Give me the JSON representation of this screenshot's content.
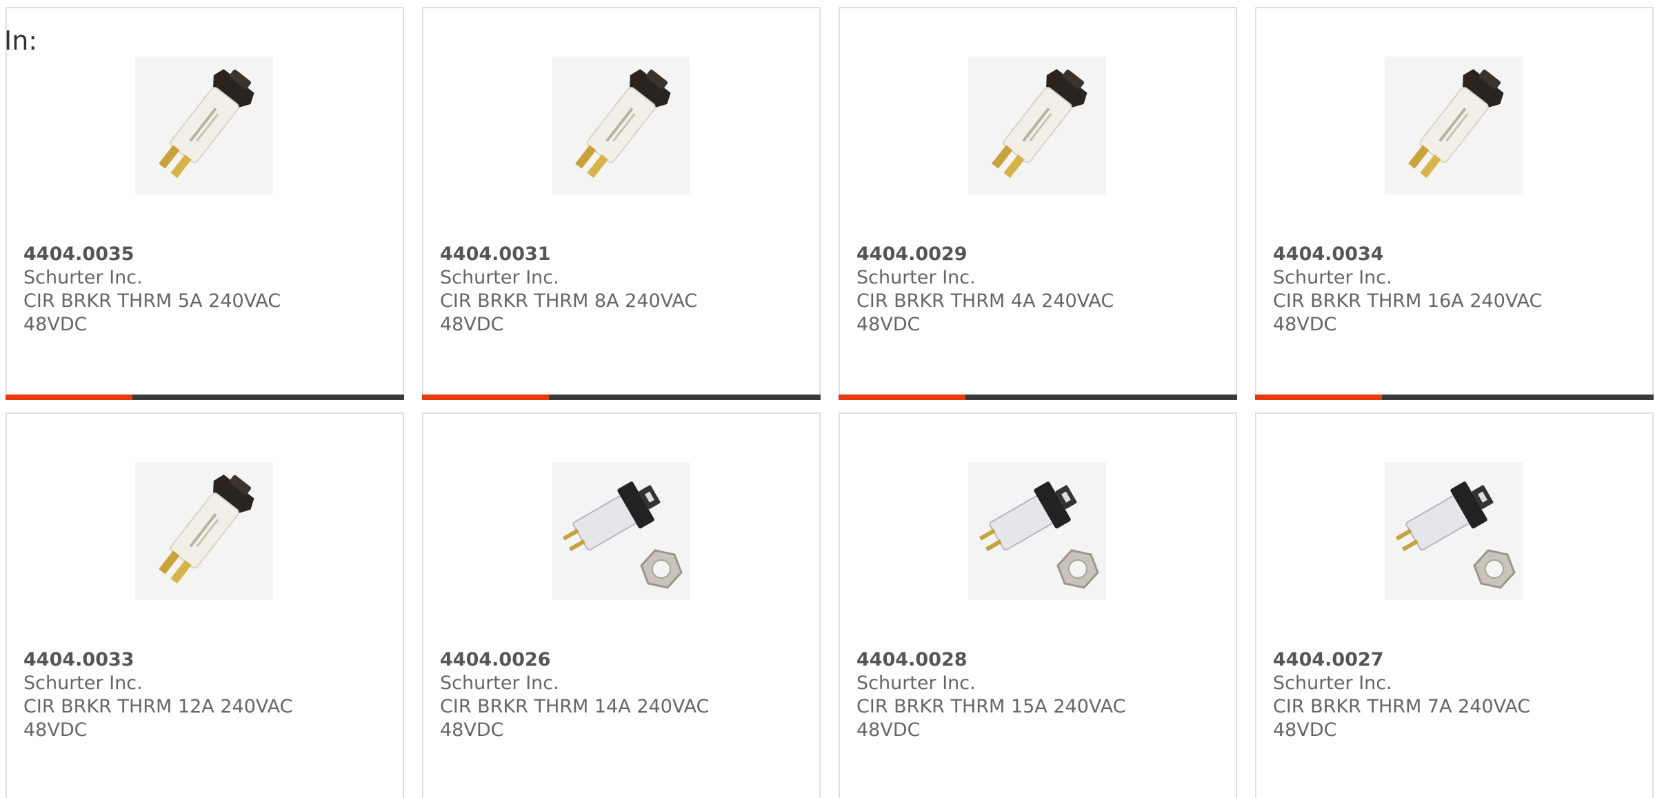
{
  "header": {
    "in_label": "In:"
  },
  "colors": {
    "accent": "#e8380d",
    "bar_dark": "#3a3a3a",
    "border": "#e0e0e0",
    "text": "#666666"
  },
  "products": [
    {
      "part_number": "4404.0035",
      "manufacturer": "Schurter Inc.",
      "desc_line1": "CIR BRKR THRM 5A 240VAC",
      "desc_line2": "48VDC",
      "image_icon": "inline-breaker-icon"
    },
    {
      "part_number": "4404.0031",
      "manufacturer": "Schurter Inc.",
      "desc_line1": "CIR BRKR THRM 8A 240VAC",
      "desc_line2": "48VDC",
      "image_icon": "inline-breaker-icon"
    },
    {
      "part_number": "4404.0029",
      "manufacturer": "Schurter Inc.",
      "desc_line1": "CIR BRKR THRM 4A 240VAC",
      "desc_line2": "48VDC",
      "image_icon": "inline-breaker-icon"
    },
    {
      "part_number": "4404.0034",
      "manufacturer": "Schurter Inc.",
      "desc_line1": "CIR BRKR THRM 16A 240VAC",
      "desc_line2": "48VDC",
      "image_icon": "inline-breaker-icon"
    },
    {
      "part_number": "4404.0033",
      "manufacturer": "Schurter Inc.",
      "desc_line1": "CIR BRKR THRM 12A 240VAC",
      "desc_line2": "48VDC",
      "image_icon": "inline-breaker-icon"
    },
    {
      "part_number": "4404.0026",
      "manufacturer": "Schurter Inc.",
      "desc_line1": "CIR BRKR THRM 14A 240VAC",
      "desc_line2": "48VDC",
      "image_icon": "panel-breaker-icon"
    },
    {
      "part_number": "4404.0028",
      "manufacturer": "Schurter Inc.",
      "desc_line1": "CIR BRKR THRM 15A 240VAC",
      "desc_line2": "48VDC",
      "image_icon": "panel-breaker-icon"
    },
    {
      "part_number": "4404.0027",
      "manufacturer": "Schurter Inc.",
      "desc_line1": "CIR BRKR THRM 7A 240VAC",
      "desc_line2": "48VDC",
      "image_icon": "panel-breaker-icon"
    }
  ]
}
